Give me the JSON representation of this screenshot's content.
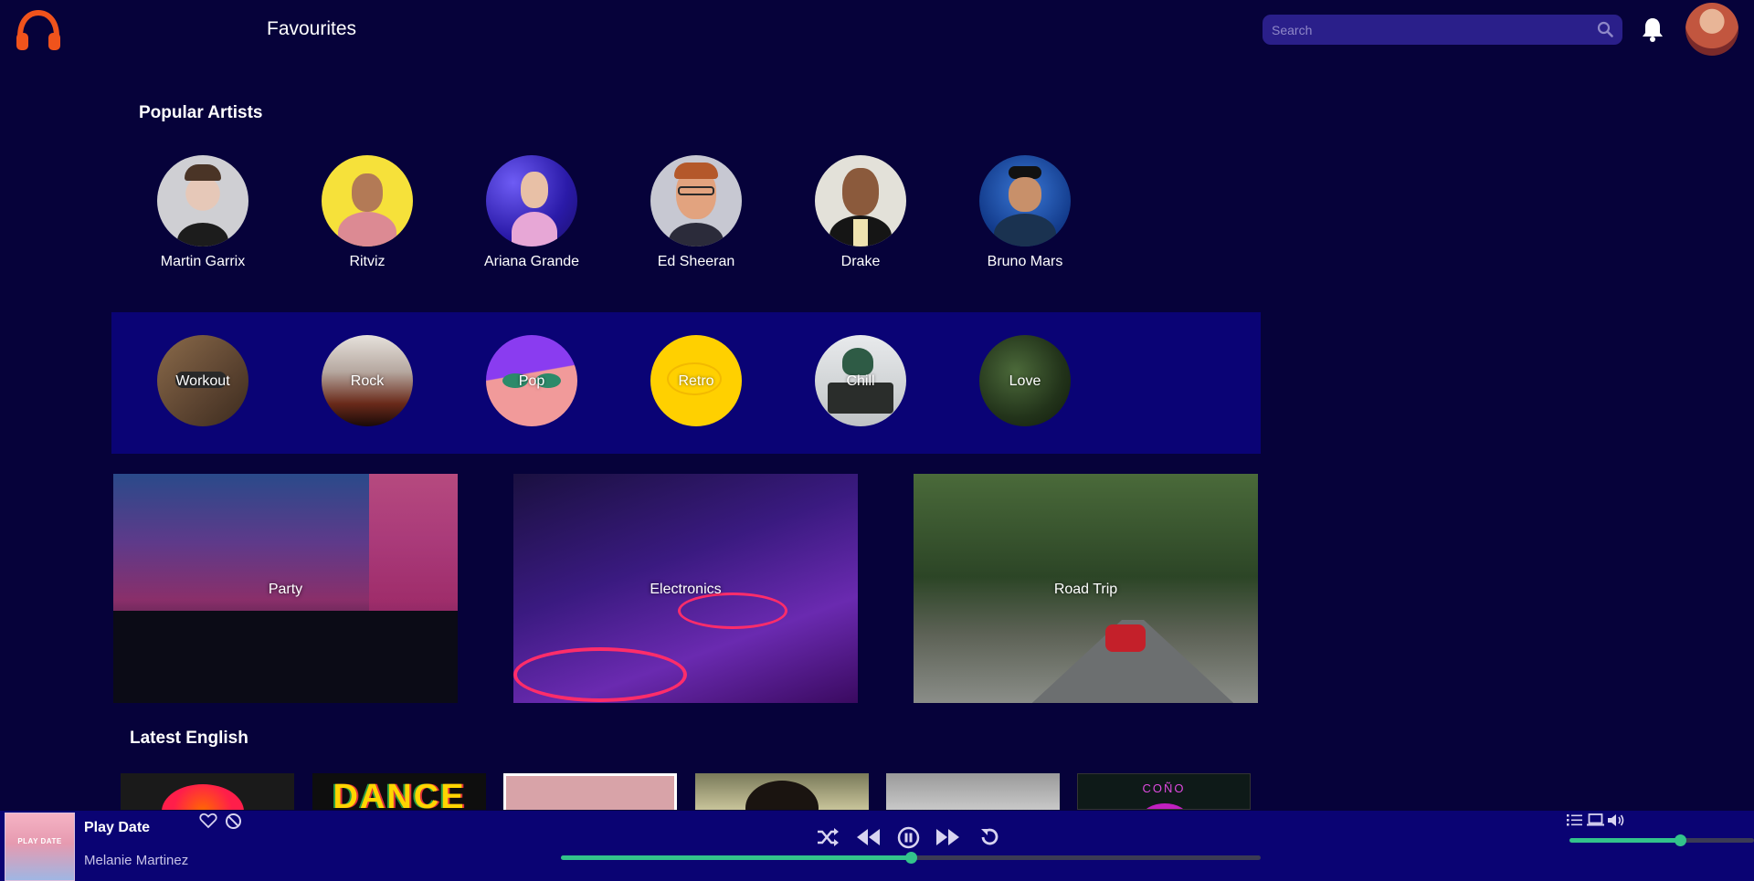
{
  "header": {
    "title": "Favourites",
    "search_placeholder": "Search",
    "logo_icon": "headphones-icon",
    "notification_icon": "bell-icon",
    "brand_color": "#f0531c"
  },
  "popular_artists": {
    "title": "Popular Artists",
    "artists": [
      {
        "name": "Martin Garrix"
      },
      {
        "name": "Ritviz"
      },
      {
        "name": "Ariana Grande"
      },
      {
        "name": "Ed Sheeran"
      },
      {
        "name": "Drake"
      },
      {
        "name": "Bruno Mars"
      }
    ]
  },
  "moods": [
    {
      "label": "Workout"
    },
    {
      "label": "Rock"
    },
    {
      "label": "Pop"
    },
    {
      "label": "Retro"
    },
    {
      "label": "Chill"
    },
    {
      "label": "Love"
    }
  ],
  "banners": [
    {
      "label": "Party"
    },
    {
      "label": "Electronics"
    },
    {
      "label": "Road Trip"
    }
  ],
  "latest_english": {
    "title": "Latest English",
    "albums": [
      {
        "text": ""
      },
      {
        "text": "DANCE"
      },
      {
        "text": ""
      },
      {
        "text": ""
      },
      {
        "text": ""
      },
      {
        "text": "COÑO"
      }
    ]
  },
  "player": {
    "cover_text": "PLAY DATE",
    "song_title": "Play Date",
    "artist": "Melanie Martinez",
    "progress": 0.5,
    "volume": 0.6,
    "accent_color": "#33c38b",
    "icons": [
      "heart-icon",
      "block-icon",
      "shuffle-icon",
      "rewind-icon",
      "pause-icon",
      "fast-forward-icon",
      "repeat-icon",
      "queue-list-icon",
      "device-icon",
      "volume-icon"
    ]
  }
}
